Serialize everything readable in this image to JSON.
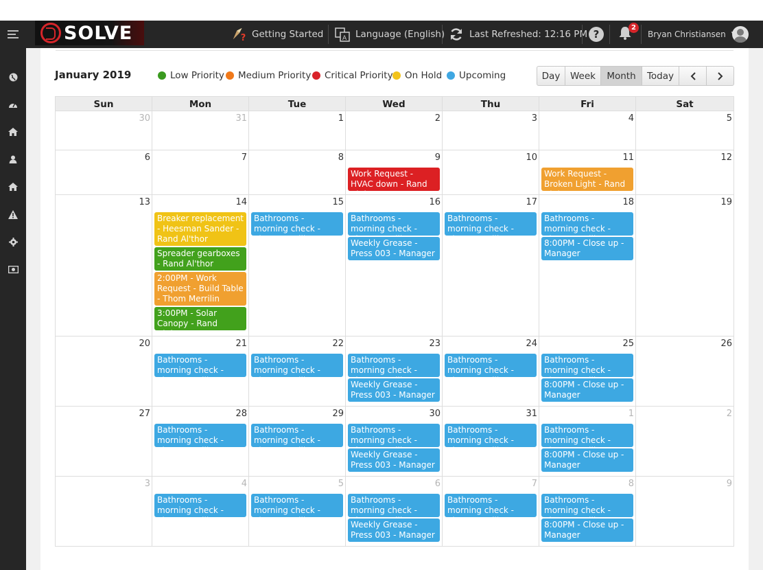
{
  "header": {
    "logo_text": "SOLVE",
    "getting_started": "Getting Started",
    "language": "Language (English)",
    "last_refreshed": "Last Refreshed: 12:16 PM",
    "notification_count": "2",
    "user_name": "Bryan Christiansen"
  },
  "colors": {
    "low": "#3a9a1f",
    "medium": "#f0791a",
    "critical": "#d9232a",
    "on_hold": "#f2c31b",
    "upcoming": "#3fa7e2",
    "orange_event": "#f0a030",
    "red_event": "#dc2023",
    "yellow_event": "#f0c316",
    "green_event": "#42a11c",
    "blue_event": "#3da8e2"
  },
  "sidebar": [
    "globe-icon",
    "dashboard-icon",
    "home-icon",
    "user-icon",
    "home-alt-icon",
    "warning-icon",
    "gear-icon",
    "money-icon"
  ],
  "calendar": {
    "title": "January 2019",
    "legend": [
      {
        "label": "Low Priority",
        "color": "#3a9a1f"
      },
      {
        "label": "Medium Priority",
        "color": "#f0791a"
      },
      {
        "label": "Critical Priority",
        "color": "#d9232a"
      },
      {
        "label": "On Hold",
        "color": "#f2c31b"
      },
      {
        "label": "Upcoming",
        "color": "#3fa7e2"
      }
    ],
    "buttons": {
      "day": "Day",
      "week": "Week",
      "month": "Month",
      "today": "Today",
      "prev": "‹",
      "next": "›"
    },
    "days_of_week": [
      "Sun",
      "Mon",
      "Tue",
      "Wed",
      "Thu",
      "Fri",
      "Sat"
    ],
    "weeks": [
      {
        "days": [
          {
            "num": "30",
            "other": true,
            "events": []
          },
          {
            "num": "31",
            "other": true,
            "events": []
          },
          {
            "num": "1",
            "events": []
          },
          {
            "num": "2",
            "events": []
          },
          {
            "num": "3",
            "events": []
          },
          {
            "num": "4",
            "events": []
          },
          {
            "num": "5",
            "events": []
          }
        ]
      },
      {
        "days": [
          {
            "num": "6",
            "events": []
          },
          {
            "num": "7",
            "events": []
          },
          {
            "num": "8",
            "events": []
          },
          {
            "num": "9",
            "events": [
              {
                "title": "Work Request - HVAC down - Rand Al'thor",
                "color": "#dc2023",
                "lines": 2
              }
            ]
          },
          {
            "num": "10",
            "events": []
          },
          {
            "num": "11",
            "events": [
              {
                "title": "Work Request - Broken Light - Rand Al'thor",
                "color": "#f0a030",
                "lines": 2
              }
            ]
          },
          {
            "num": "12",
            "events": []
          }
        ]
      },
      {
        "days": [
          {
            "num": "13",
            "events": []
          },
          {
            "num": "14",
            "events": [
              {
                "title": "Breaker replacement - Heesman Sander - Rand Al'thor",
                "color": "#f0c316",
                "lines": 3
              },
              {
                "title": "Spreader gearboxes - Rand Al'thor",
                "color": "#42a11c",
                "lines": 2
              },
              {
                "title": "2:00PM - Work Request - Build Table - Thom Merrilin",
                "color": "#f0a030",
                "lines": 3
              },
              {
                "title": "3:00PM - Solar Canopy - Rand Al'thor",
                "color": "#42a11c",
                "lines": 2
              }
            ]
          },
          {
            "num": "15",
            "events": [
              {
                "title": "Bathrooms - morning check - Thom Merrilin",
                "color": "#3da8e2",
                "lines": 2
              }
            ]
          },
          {
            "num": "16",
            "events": [
              {
                "title": "Bathrooms - morning check - Thom Merrilin",
                "color": "#3da8e2",
                "lines": 2
              },
              {
                "title": "Weekly Grease - Press 003 - Manager",
                "color": "#3da8e2",
                "lines": 2
              }
            ]
          },
          {
            "num": "17",
            "events": [
              {
                "title": "Bathrooms - morning check - Thom Merrilin",
                "color": "#3da8e2",
                "lines": 2
              }
            ]
          },
          {
            "num": "18",
            "events": [
              {
                "title": "Bathrooms - morning check - Thom Merrilin",
                "color": "#3da8e2",
                "lines": 2
              },
              {
                "title": "8:00PM - Close up - Manager",
                "color": "#3da8e2",
                "lines": 2
              }
            ]
          },
          {
            "num": "19",
            "events": []
          }
        ]
      },
      {
        "days": [
          {
            "num": "20",
            "events": []
          },
          {
            "num": "21",
            "events": [
              {
                "title": "Bathrooms - morning check - Thom Merrilin",
                "color": "#3da8e2",
                "lines": 2
              }
            ]
          },
          {
            "num": "22",
            "events": [
              {
                "title": "Bathrooms - morning check - Thom Merrilin",
                "color": "#3da8e2",
                "lines": 2
              }
            ]
          },
          {
            "num": "23",
            "events": [
              {
                "title": "Bathrooms - morning check - Thom Merrilin",
                "color": "#3da8e2",
                "lines": 2
              },
              {
                "title": "Weekly Grease - Press 003 - Manager",
                "color": "#3da8e2",
                "lines": 2
              }
            ]
          },
          {
            "num": "24",
            "events": [
              {
                "title": "Bathrooms - morning check - Thom Merrilin",
                "color": "#3da8e2",
                "lines": 2
              }
            ]
          },
          {
            "num": "25",
            "events": [
              {
                "title": "Bathrooms - morning check - Thom Merrilin",
                "color": "#3da8e2",
                "lines": 2
              },
              {
                "title": "8:00PM - Close up - Manager",
                "color": "#3da8e2",
                "lines": 2
              }
            ]
          },
          {
            "num": "26",
            "events": []
          }
        ]
      },
      {
        "days": [
          {
            "num": "27",
            "events": []
          },
          {
            "num": "28",
            "events": [
              {
                "title": "Bathrooms - morning check - Thom Merrilin",
                "color": "#3da8e2",
                "lines": 2
              }
            ]
          },
          {
            "num": "29",
            "events": [
              {
                "title": "Bathrooms - morning check - Thom Merrilin",
                "color": "#3da8e2",
                "lines": 2
              }
            ]
          },
          {
            "num": "30",
            "events": [
              {
                "title": "Bathrooms - morning check - Thom Merrilin",
                "color": "#3da8e2",
                "lines": 2
              },
              {
                "title": "Weekly Grease - Press 003 - Manager",
                "color": "#3da8e2",
                "lines": 2
              }
            ]
          },
          {
            "num": "31",
            "events": [
              {
                "title": "Bathrooms - morning check - Thom Merrilin",
                "color": "#3da8e2",
                "lines": 2
              }
            ]
          },
          {
            "num": "1",
            "other": true,
            "events": [
              {
                "title": "Bathrooms - morning check - Thom Merrilin",
                "color": "#3da8e2",
                "lines": 2
              },
              {
                "title": "8:00PM - Close up - Manager",
                "color": "#3da8e2",
                "lines": 2
              }
            ]
          },
          {
            "num": "2",
            "other": true,
            "events": []
          }
        ]
      },
      {
        "days": [
          {
            "num": "3",
            "other": true,
            "events": []
          },
          {
            "num": "4",
            "other": true,
            "events": [
              {
                "title": "Bathrooms - morning check - Thom Merrilin",
                "color": "#3da8e2",
                "lines": 2
              }
            ]
          },
          {
            "num": "5",
            "other": true,
            "events": [
              {
                "title": "Bathrooms - morning check - Thom Merrilin",
                "color": "#3da8e2",
                "lines": 2
              }
            ]
          },
          {
            "num": "6",
            "other": true,
            "events": [
              {
                "title": "Bathrooms - morning check - Thom Merrilin",
                "color": "#3da8e2",
                "lines": 2
              },
              {
                "title": "Weekly Grease - Press 003 - Manager",
                "color": "#3da8e2",
                "lines": 2
              }
            ]
          },
          {
            "num": "7",
            "other": true,
            "events": [
              {
                "title": "Bathrooms - morning check - Thom Merrilin",
                "color": "#3da8e2",
                "lines": 2
              }
            ]
          },
          {
            "num": "8",
            "other": true,
            "events": [
              {
                "title": "Bathrooms - morning check - Thom Merrilin",
                "color": "#3da8e2",
                "lines": 2
              },
              {
                "title": "8:00PM - Close up - Manager",
                "color": "#3da8e2",
                "lines": 2
              }
            ]
          },
          {
            "num": "9",
            "other": true,
            "events": []
          }
        ]
      }
    ]
  }
}
